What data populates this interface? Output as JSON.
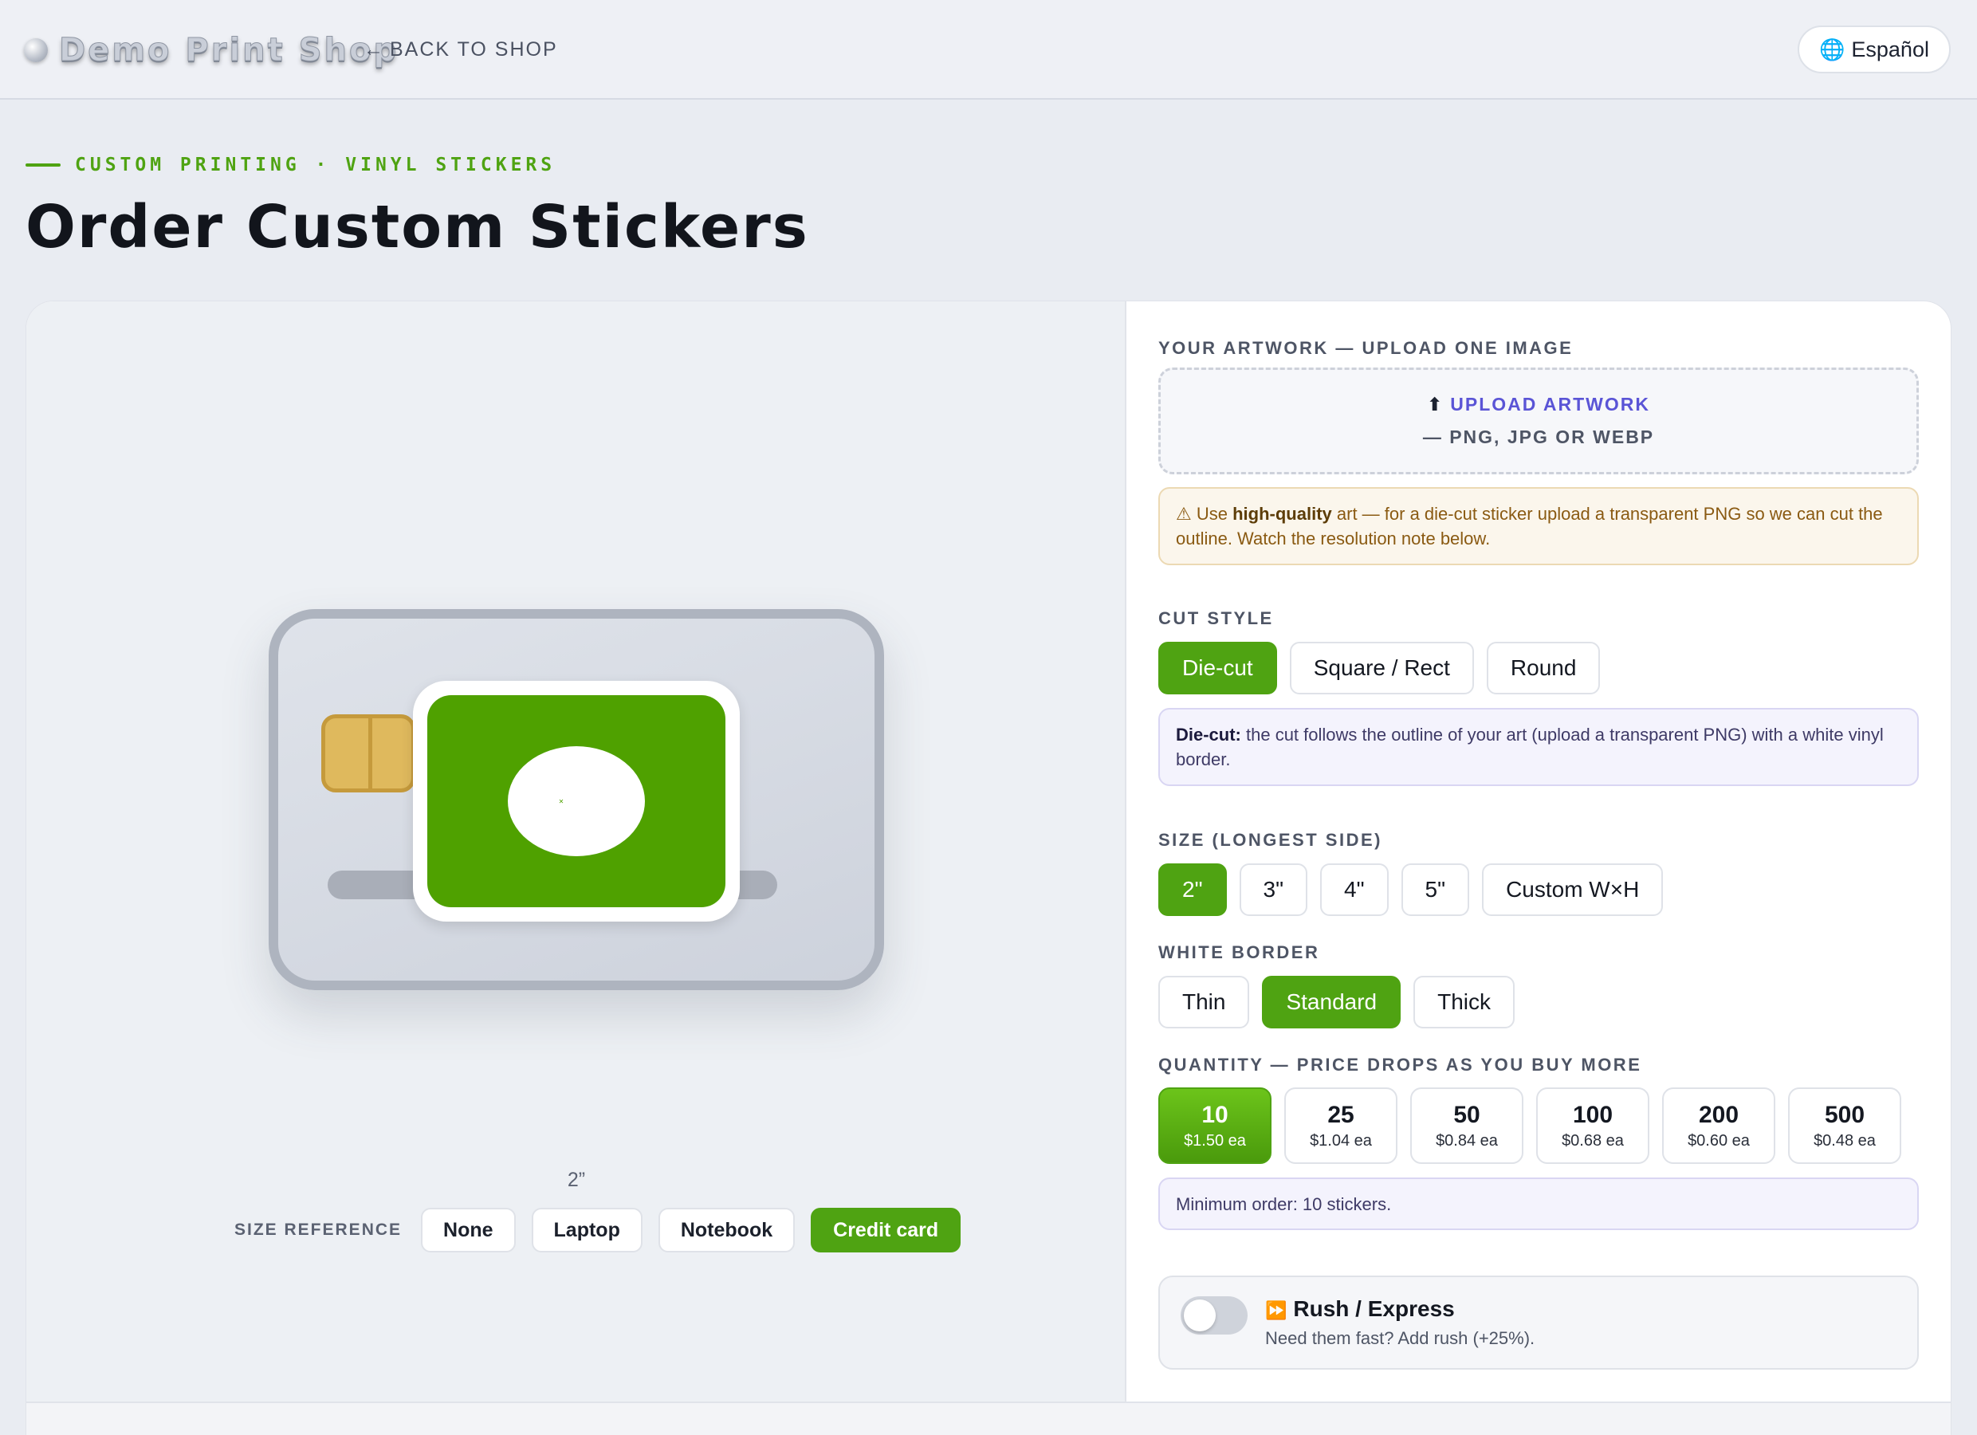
{
  "header": {
    "brand": "Demo Print Shop",
    "back_label": "BACK TO SHOP",
    "back_arrow": "←",
    "language": "Español",
    "globe_icon": "🌐"
  },
  "hero": {
    "eyebrow": "CUSTOM PRINTING · VINYL STICKERS",
    "title": "Order Custom Stickers"
  },
  "preview": {
    "size_caption": "2”",
    "size_reference_label": "SIZE REFERENCE",
    "size_reference_options": [
      "None",
      "Laptop",
      "Notebook",
      "Credit card"
    ],
    "size_reference_selected": "Credit card",
    "sticker_color": "#4fa100",
    "sticker_mark": "✕"
  },
  "artwork": {
    "label": "YOUR ARTWORK — UPLOAD ONE IMAGE",
    "upload_icon": "⬆",
    "upload_label": "UPLOAD ARTWORK",
    "upload_formats": "— PNG, JPG OR WEBP",
    "warning_icon": "⚠",
    "warning_pre": "Use ",
    "warning_bold": "high-quality",
    "warning_post": " art — for a die-cut sticker upload a transparent PNG so we can cut the outline. Watch the resolution note below."
  },
  "cut_style": {
    "label": "CUT STYLE",
    "options": [
      "Die-cut",
      "Square / Rect",
      "Round"
    ],
    "selected": "Die-cut",
    "info_bold": "Die-cut:",
    "info_text": " the cut follows the outline of your art (upload a transparent PNG) with a white vinyl border."
  },
  "size": {
    "label": "SIZE (LONGEST SIDE)",
    "options": [
      "2\"",
      "3\"",
      "4\"",
      "5\"",
      "Custom W×H"
    ],
    "selected": "2\""
  },
  "border": {
    "label": "WHITE BORDER",
    "options": [
      "Thin",
      "Standard",
      "Thick"
    ],
    "selected": "Standard"
  },
  "quantity": {
    "label": "QUANTITY — PRICE DROPS AS YOU BUY MORE",
    "options": [
      {
        "qty": "10",
        "price": "$1.50 ea"
      },
      {
        "qty": "25",
        "price": "$1.04 ea"
      },
      {
        "qty": "50",
        "price": "$0.84 ea"
      },
      {
        "qty": "100",
        "price": "$0.68 ea"
      },
      {
        "qty": "200",
        "price": "$0.60 ea"
      },
      {
        "qty": "500",
        "price": "$0.48 ea"
      }
    ],
    "selected": "10",
    "note": "Minimum order: 10 stickers."
  },
  "rush": {
    "icon": "⏩",
    "title": "Rush / Express",
    "description": "Need them fast? Add rush (+25%).",
    "enabled": false
  },
  "colors": {
    "accent": "#4fa312",
    "link": "#5a54d6",
    "warning_bg": "#fbf6ec",
    "info_bg": "#f4f3fd"
  }
}
